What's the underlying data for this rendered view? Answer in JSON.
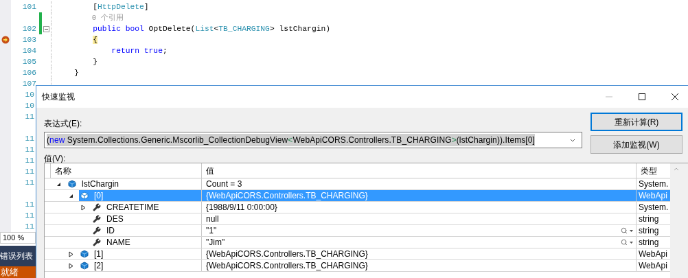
{
  "editor": {
    "lines": [
      {
        "kind": "code",
        "number": "101",
        "current": false,
        "changed": false,
        "tokens": [
          {
            "kind": "plain",
            "text": "        ["
          },
          {
            "kind": "type",
            "text": "HttpDelete"
          },
          {
            "kind": "plain",
            "text": "]"
          }
        ]
      },
      {
        "kind": "codelens",
        "text": "        0 个引用",
        "changed": true
      },
      {
        "kind": "code",
        "number": "102",
        "current": false,
        "changed": true,
        "fold": true,
        "tokens": [
          {
            "kind": "keyword",
            "text": "        public"
          },
          {
            "kind": "keyword",
            "text": " bool"
          },
          {
            "kind": "plain",
            "text": " OptDelete("
          },
          {
            "kind": "type",
            "text": "List"
          },
          {
            "kind": "plain",
            "text": "<"
          },
          {
            "kind": "type",
            "text": "TB_CHARGING"
          },
          {
            "kind": "plain",
            "text": "> lstChargin)"
          }
        ]
      },
      {
        "kind": "code",
        "number": "103",
        "current": true,
        "changed": false,
        "tokens": [
          {
            "kind": "brace_match",
            "text": "        {"
          }
        ]
      },
      {
        "kind": "code",
        "number": "104",
        "current": false,
        "changed": false,
        "tokens": [
          {
            "kind": "keyword",
            "text": "            return"
          },
          {
            "kind": "keyword",
            "text": " true"
          },
          {
            "kind": "plain",
            "text": ";"
          }
        ]
      },
      {
        "kind": "code",
        "number": "105",
        "current": false,
        "changed": false,
        "tokens": [
          {
            "kind": "plain",
            "text": "        }"
          }
        ]
      },
      {
        "kind": "code",
        "number": "106",
        "current": false,
        "changed": false,
        "tokens": [
          {
            "kind": "plain",
            "text": "    }"
          }
        ]
      },
      {
        "kind": "code",
        "number": "107",
        "current": false,
        "changed": false
      }
    ],
    "hidden_line_numbers": [
      {
        "kind": "number",
        "text": "10"
      },
      {
        "kind": "number",
        "text": "10"
      },
      {
        "kind": "number",
        "text": "11"
      },
      {
        "kind": "gap"
      },
      {
        "kind": "number",
        "text": "11"
      },
      {
        "kind": "number",
        "text": "11"
      },
      {
        "kind": "number",
        "text": "11"
      },
      {
        "kind": "number",
        "text": "11"
      },
      {
        "kind": "number",
        "text": "11"
      },
      {
        "kind": "gap"
      },
      {
        "kind": "number",
        "text": "11"
      },
      {
        "kind": "number",
        "text": "11"
      },
      {
        "kind": "number",
        "text": "11"
      }
    ],
    "zoom": "100 %"
  },
  "bottom_panel": {
    "tab": "错误列表",
    "status": "就绪"
  },
  "dialog": {
    "title": "快速监视",
    "expression_label": "表达式(E):",
    "expression": [
      {
        "kind": "plain",
        "text": "("
      },
      {
        "kind": "keyword",
        "text": "new"
      },
      {
        "kind": "plain",
        "text": " System.Collections.Generic.Mscorlib_CollectionDebugView"
      },
      {
        "kind": "bracket",
        "text": "<"
      },
      {
        "kind": "plain",
        "text": "WebApiCORS.Controllers.TB_CHARGING"
      },
      {
        "kind": "bracket",
        "text": ">"
      },
      {
        "kind": "plain",
        "text": "(lstChargin)).Items[0]"
      }
    ],
    "buttons": [
      {
        "label": "重新计算(R)",
        "focused": true
      },
      {
        "label": "添加监视(W)",
        "focused": false
      }
    ],
    "value_label": "值(V):",
    "columns": [
      "名称",
      "值",
      "类型"
    ],
    "rows": [
      {
        "name": "lstChargin",
        "value": "Count = 3",
        "type": "System.",
        "kind": "object",
        "expanded": true,
        "selected": false,
        "visualizer": false,
        "children": [
          {
            "name": "[0]",
            "value": "{WebApiCORS.Controllers.TB_CHARGING}",
            "type": "WebApi",
            "kind": "object",
            "expanded": true,
            "selected": true,
            "visualizer": false,
            "children": [
              {
                "name": "CREATETIME",
                "value": "{1988/9/11 0:00:00}",
                "type": "System.",
                "kind": "property",
                "expanded": false,
                "selected": false,
                "visualizer": false
              },
              {
                "name": "DES",
                "value": "null",
                "type": "string",
                "kind": "property",
                "selected": false,
                "visualizer": false
              },
              {
                "name": "ID",
                "value": "\"1\"",
                "type": "string",
                "kind": "property",
                "selected": false,
                "visualizer": true
              },
              {
                "name": "NAME",
                "value": "\"Jim\"",
                "type": "string",
                "kind": "property",
                "selected": false,
                "visualizer": true
              }
            ]
          },
          {
            "name": "[1]",
            "value": "{WebApiCORS.Controllers.TB_CHARGING}",
            "type": "WebApi",
            "kind": "object",
            "expanded": false,
            "selected": false,
            "visualizer": false
          },
          {
            "name": "[2]",
            "value": "{WebApiCORS.Controllers.TB_CHARGING}",
            "type": "WebApi",
            "kind": "object",
            "expanded": false,
            "selected": false,
            "visualizer": false
          }
        ]
      }
    ]
  }
}
